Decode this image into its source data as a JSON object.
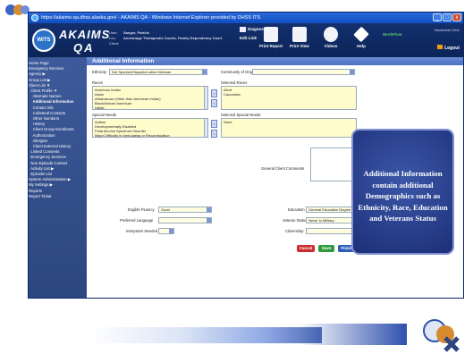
{
  "window": {
    "title": "https://akaims-qa.dhss.alaska.gov/ - AKAIMS QA - Windows Internet Explorer provided by DHSS ITS",
    "minimize": "_",
    "maximize": "□",
    "close": "x"
  },
  "header": {
    "logo": "WITS",
    "brand_line1": "AKAIMS",
    "brand_line2": "QA",
    "user_label": "User:",
    "user_value": "Sanger, Patrick",
    "loc_label": "Loc:",
    "loc_value": "Anchorage Therapeutic Courts, Family Dependency Court",
    "client_label": "Client:",
    "diagnostics": "Diagnostics",
    "tools": [
      "Edit Link",
      "Print Report",
      "Print View",
      "Videos",
      "Help"
    ],
    "partner": "WorkFlow",
    "date": "November 2011",
    "logout": "Logout"
  },
  "nav": [
    "Home Page",
    "Emergency Services",
    "Agency ▶",
    "Group List ▶",
    "Client List ▼",
    "  Client Profile ▼",
    "    Alternate Names",
    "    Additional Information",
    "    Contact Info",
    "    Collateral Contacts",
    "    Other Numbers",
    "    History",
    "    Client Group Enrollment",
    "    Authorization",
    "    Allergies",
    "    Client External History",
    "  Linked Consents",
    "  Emergency Services",
    "  Non-Episode Contact",
    "  Activity List ▶",
    "  Episode List",
    "System Administration ▶",
    "My Settings ▶",
    "Reports",
    "Report Tickat"
  ],
  "page": {
    "title": "Additional Information",
    "ethnicity_label": "Ethnicity",
    "ethnicity_value": "Not Spanish/Hispanic/Latino Mexican",
    "community_label": "Community of Origin",
    "community_value": "",
    "races_label": "Races",
    "races_list": [
      "American Indian",
      "Asian",
      "Athabascan (Other than American Indian)",
      "Black/African American",
      "Haida"
    ],
    "selected_races_label": "Selected Races",
    "selected_races": [
      "Aleut",
      "Caucasian"
    ],
    "special_needs_label": "Special Needs",
    "special_needs_list": [
      "Autism",
      "Developmentally Disabled",
      "Fetal Alcohol Spectrum Disorder",
      "Major Difficulty in Ambulating or Recombulation"
    ],
    "selected_special_needs_label": "Selected Special Needs",
    "selected_special_needs": [
      "None"
    ],
    "general_comments_label": "General Client Comments",
    "english_fluency_label": "English Fluency",
    "english_fluency_value": "Good",
    "preferred_language_label": "Preferred Language",
    "preferred_language_value": "",
    "interpreter_label": "Interpreter Needed",
    "interpreter_value": "",
    "education_label": "Education",
    "education_value": "General Education Degree (GED)",
    "veteran_label": "Veteran Status",
    "veteran_value": "Never in Military",
    "citizenship_label": "Citizenship",
    "citizenship_value": "",
    "cancel": "Cancel",
    "save": "Save",
    "finish": "Finish",
    "arrow_add": ">",
    "arrow_remove": "<"
  },
  "callout": {
    "text": "Additional Information contain additional Demographics such as Ethnicity, Race, Education and Veterans Status"
  },
  "colors": {
    "header": "#13306e",
    "nav": "#3d5a9a",
    "field": "#fffccc",
    "cancel": "#cc2b2b",
    "save": "#2f9a3a",
    "finish": "#2f5db8"
  }
}
